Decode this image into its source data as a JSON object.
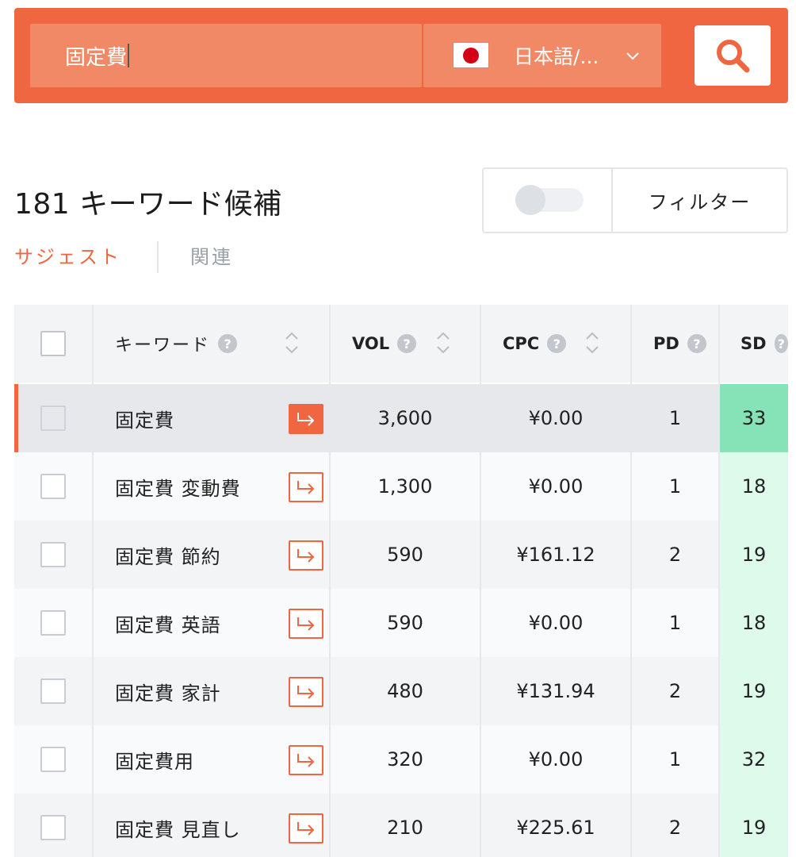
{
  "search": {
    "query": "固定費",
    "language_label": "日本語/...",
    "colors": {
      "brand": "#ef6640",
      "field": "#f28966"
    }
  },
  "header": {
    "title": "181 キーワード候補",
    "filter_label": "フィルター",
    "toggle_on": false
  },
  "tabs": [
    {
      "label": "サジェスト",
      "active": true
    },
    {
      "label": "関連",
      "active": false
    }
  ],
  "table": {
    "columns": {
      "keyword": "キーワード",
      "vol": "VOL",
      "cpc": "CPC",
      "pd": "PD",
      "sd": "SD"
    },
    "help_glyph": "?",
    "rows": [
      {
        "keyword": "固定費",
        "vol": "3,600",
        "cpc": "¥0.00",
        "pd": "1",
        "sd": "33"
      },
      {
        "keyword": "固定費 変動費",
        "vol": "1,300",
        "cpc": "¥0.00",
        "pd": "1",
        "sd": "18"
      },
      {
        "keyword": "固定費 節約",
        "vol": "590",
        "cpc": "¥161.12",
        "pd": "2",
        "sd": "19"
      },
      {
        "keyword": "固定費 英語",
        "vol": "590",
        "cpc": "¥0.00",
        "pd": "1",
        "sd": "18"
      },
      {
        "keyword": "固定費 家計",
        "vol": "480",
        "cpc": "¥131.94",
        "pd": "2",
        "sd": "19"
      },
      {
        "keyword": "固定費用",
        "vol": "320",
        "cpc": "¥0.00",
        "pd": "1",
        "sd": "32"
      },
      {
        "keyword": "固定費 見直し",
        "vol": "210",
        "cpc": "¥225.61",
        "pd": "2",
        "sd": "19"
      }
    ]
  }
}
